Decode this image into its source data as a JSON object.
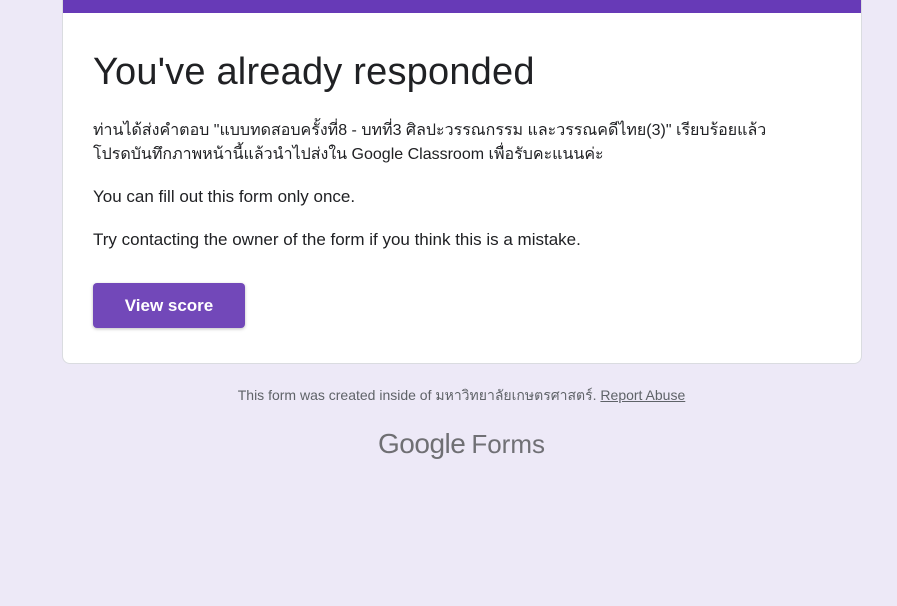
{
  "card": {
    "title": "You've already responded",
    "message_line1": "ท่านได้ส่งคำตอบ \"แบบทดสอบครั้งที่8 - บทที่3 ศิลปะวรรณกรรม และวรรณคดีไทย(3)\" เรียบร้อยแล้ว",
    "message_line2": "โปรดบันทึกภาพหน้านี้แล้วนำไปส่งใน Google Classroom เพื่อรับคะแนนค่ะ",
    "note_once": "You can fill out this form only once.",
    "note_contact": "Try contacting the owner of the form if you think this is a mistake.",
    "view_score_label": "View score"
  },
  "footer": {
    "created_text": "This form was created inside of มหาวิทยาลัยเกษตรศาสตร์.",
    "report_abuse_label": "Report Abuse"
  },
  "brand": {
    "google": "Google",
    "forms": "Forms"
  },
  "colors": {
    "accent": "#673ab7",
    "button": "#7248b9",
    "background": "#ede9f7"
  }
}
